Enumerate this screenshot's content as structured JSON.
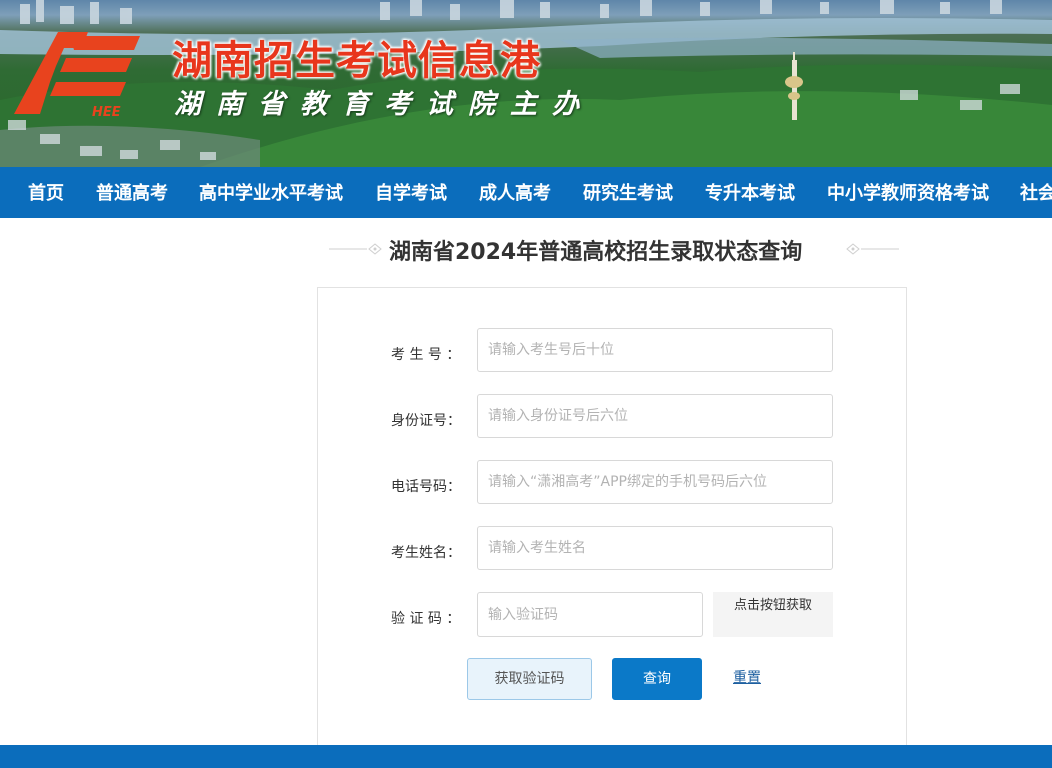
{
  "header": {
    "site_title": "湖南招生考试信息港",
    "site_subtitle": "湖南省教育考试院主办",
    "logo_text": "HEE"
  },
  "nav": {
    "items": [
      {
        "label": "首页"
      },
      {
        "label": "普通高考"
      },
      {
        "label": "高中学业水平考试"
      },
      {
        "label": "自学考试"
      },
      {
        "label": "成人高考"
      },
      {
        "label": "研究生考试"
      },
      {
        "label": "专升本考试"
      },
      {
        "label": "中小学教师资格考试"
      },
      {
        "label": "社会"
      }
    ]
  },
  "page": {
    "title": "湖南省2024年普通高校招生录取状态查询"
  },
  "form": {
    "fields": [
      {
        "label": "考 生 号 ：",
        "placeholder": "请输入考生号后十位",
        "value": ""
      },
      {
        "label": "身份证号：",
        "placeholder": "请输入身份证号后六位",
        "value": ""
      },
      {
        "label": "电话号码：",
        "placeholder": "请输入“潇湘高考”APP绑定的手机号码后六位",
        "value": ""
      },
      {
        "label": "考生姓名：",
        "placeholder": "请输入考生姓名",
        "value": ""
      },
      {
        "label": "验  证  码 ：",
        "placeholder": "输入验证码",
        "value": ""
      }
    ],
    "captcha_hint": "点击按钮获取",
    "buttons": {
      "get_code": "获取验证码",
      "query": "查询",
      "reset": "重置"
    }
  },
  "colors": {
    "nav_bg": "#0b6dbc",
    "title_red": "#e8361c",
    "query_button": "#0b79c8",
    "link_blue": "#1d5fa0"
  }
}
